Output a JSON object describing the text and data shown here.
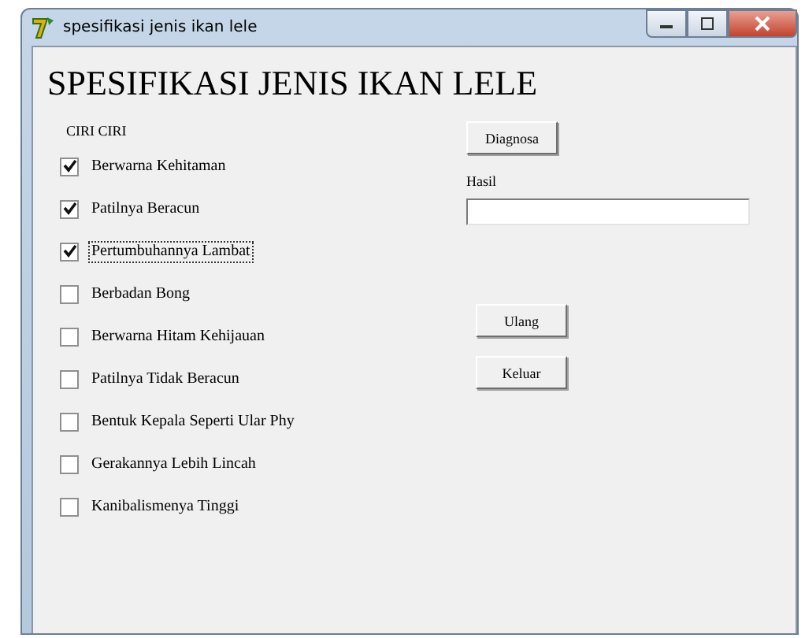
{
  "window": {
    "title": "spesifikasi jenis ikan lele"
  },
  "heading": "SPESIFIKASI JENIS IKAN LELE",
  "group_label": "CIRI CIRI",
  "criteria": [
    {
      "label": "Berwarna Kehitaman",
      "checked": true,
      "focused": false
    },
    {
      "label": "Patilnya Beracun",
      "checked": true,
      "focused": false
    },
    {
      "label": "Pertumbuhannya Lambat",
      "checked": true,
      "focused": true
    },
    {
      "label": "Berbadan Bong",
      "checked": false,
      "focused": false
    },
    {
      "label": "Berwarna Hitam Kehijauan",
      "checked": false,
      "focused": false
    },
    {
      "label": "Patilnya Tidak Beracun",
      "checked": false,
      "focused": false
    },
    {
      "label": "Bentuk Kepala Seperti Ular Phy",
      "checked": false,
      "focused": false
    },
    {
      "label": "Gerakannya Lebih Lincah",
      "checked": false,
      "focused": false
    },
    {
      "label": "Kanibalismenya Tinggi",
      "checked": false,
      "focused": false
    }
  ],
  "diagnose_button": "Diagnosa",
  "result": {
    "label": "Hasil"
  },
  "buttons": [
    "Ulang",
    "Keluar"
  ]
}
